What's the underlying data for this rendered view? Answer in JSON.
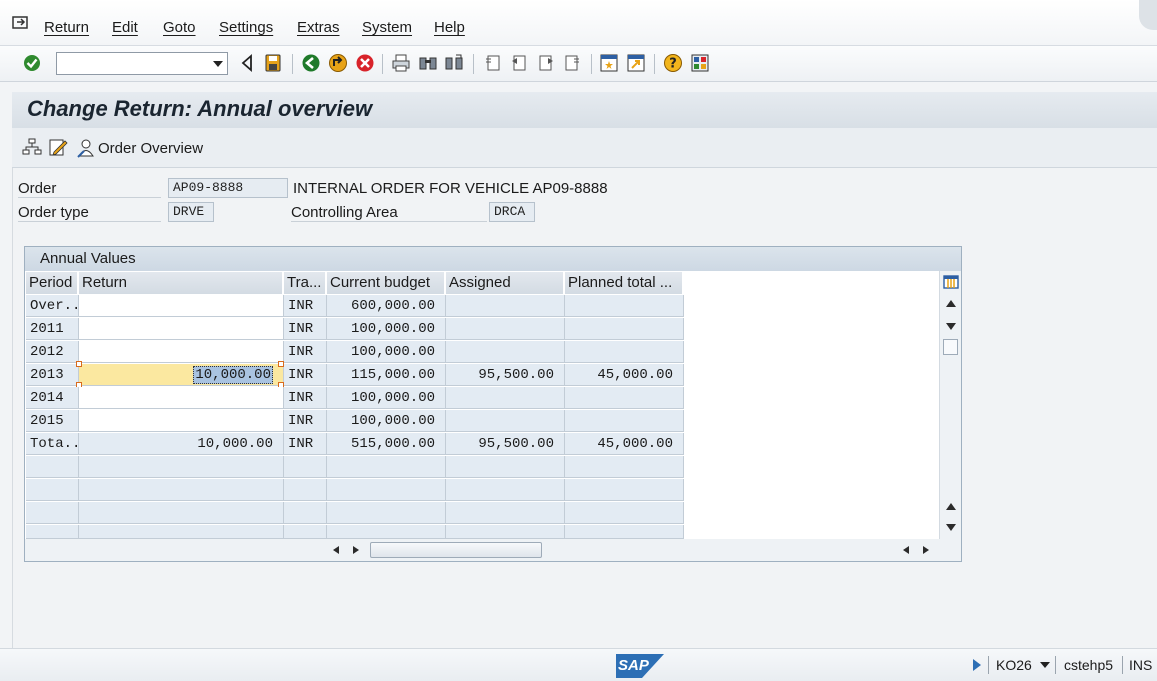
{
  "menu": {
    "items": [
      "Return",
      "Edit",
      "Goto",
      "Settings",
      "Extras",
      "System",
      "Help"
    ]
  },
  "toolbar": {
    "command_field_value": "",
    "icons": [
      "enter-icon",
      "back-icon",
      "save-icon",
      "green-back-icon",
      "exit-icon",
      "cancel-icon",
      "print-icon",
      "find-icon",
      "find-next-icon",
      "first-page-icon",
      "previous-page-icon",
      "next-page-icon",
      "last-page-icon",
      "create-session-icon",
      "shortcut-icon",
      "help-icon",
      "layout-icon"
    ]
  },
  "title": "Change Return: Annual overview",
  "app_toolbar": {
    "icons": [
      "hierarchy-icon",
      "edit-icon",
      "person-icon"
    ],
    "order_overview_label": "Order Overview"
  },
  "header": {
    "order_label": "Order",
    "order_value": "AP09-8888",
    "order_desc": "INTERNAL ORDER FOR VEHICLE AP09-8888",
    "order_type_label": "Order type",
    "order_type_value": "DRVE",
    "controlling_area_label": "Controlling Area",
    "controlling_area_value": "DRCA"
  },
  "annual_values": {
    "title": "Annual Values",
    "columns": [
      "Period",
      "Return",
      "Tra...",
      "Current budget",
      "Assigned",
      "Planned total ..."
    ],
    "rows": [
      {
        "period": "Over..",
        "return": "",
        "tra": "INR",
        "current_budget": "600,000.00",
        "assigned": "",
        "planned_total": ""
      },
      {
        "period": "2011",
        "return": "",
        "tra": "INR",
        "current_budget": "100,000.00",
        "assigned": "",
        "planned_total": ""
      },
      {
        "period": "2012",
        "return": "",
        "tra": "INR",
        "current_budget": "100,000.00",
        "assigned": "",
        "planned_total": ""
      },
      {
        "period": "2013",
        "return": "10,000.00",
        "tra": "INR",
        "current_budget": "115,000.00",
        "assigned": "95,500.00",
        "planned_total": "45,000.00"
      },
      {
        "period": "2014",
        "return": "",
        "tra": "INR",
        "current_budget": "100,000.00",
        "assigned": "",
        "planned_total": ""
      },
      {
        "period": "2015",
        "return": "",
        "tra": "INR",
        "current_budget": "100,000.00",
        "assigned": "",
        "planned_total": ""
      },
      {
        "period": "Tota..",
        "return": "10,000.00",
        "tra": "INR",
        "current_budget": "515,000.00",
        "assigned": "95,500.00",
        "planned_total": "45,000.00"
      }
    ]
  },
  "status": {
    "logo_text": "SAP",
    "transaction": "KO26",
    "server": "cstehp5",
    "mode": "INS"
  },
  "colors": {
    "accent_blue": "#2d6fb5",
    "selection_yellow": "#fbe8a0",
    "cell_blue": "#e3ebf3"
  }
}
